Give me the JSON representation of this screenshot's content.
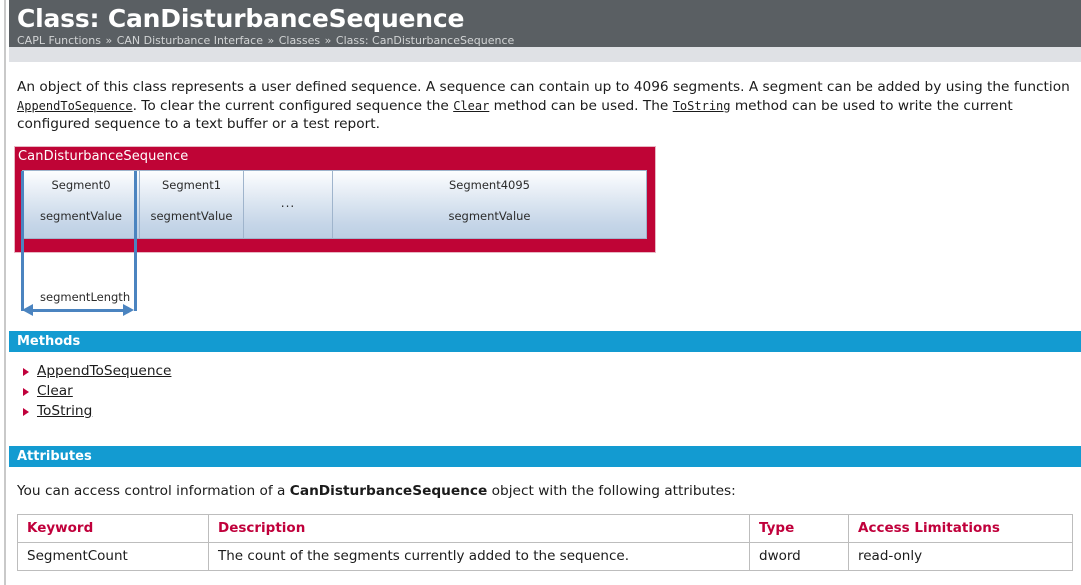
{
  "header": {
    "title": "Class: CanDisturbanceSequence",
    "breadcrumb": [
      "CAPL Functions",
      "CAN Disturbance Interface",
      "Classes",
      "Class: CanDisturbanceSequence"
    ],
    "separator": "»"
  },
  "intro": {
    "part1": "An object of this class represents a user defined sequence. A sequence can contain up to 4096 segments. A segment can be added by using the function ",
    "link1": "AppendToSequence",
    "part2": ". To clear the current configured sequence the ",
    "link2": "Clear",
    "part3": " method can be used. The ",
    "link3": "ToString",
    "part4": " method can be used to write the current configured sequence to a text buffer or a test report."
  },
  "diagram": {
    "class_label": "CanDisturbanceSequence",
    "segments": [
      {
        "name": "Segment0",
        "value": "segmentValue"
      },
      {
        "name": "Segment1",
        "value": "segmentValue"
      },
      {
        "name": "",
        "value": "",
        "ellipsis": "..."
      },
      {
        "name": "Segment4095",
        "value": "segmentValue"
      }
    ],
    "measure_label": "segmentLength",
    "colors": {
      "class_box": "#bf0436",
      "segment_border": "#9fb4cc",
      "measure_line": "#4b84c0"
    }
  },
  "methods": {
    "section_title": "Methods",
    "items": [
      "AppendToSequence",
      "Clear",
      "ToString"
    ]
  },
  "attributes": {
    "section_title": "Attributes",
    "intro_before": "You can access control information of a ",
    "intro_bold": "CanDisturbanceSequence",
    "intro_after": " object with the following attributes:",
    "table": {
      "headers": [
        "Keyword",
        "Description",
        "Type",
        "Access Limitations"
      ],
      "rows": [
        {
          "keyword": "SegmentCount",
          "description": "The count of the segments currently added to the sequence.",
          "type": "dword",
          "access": "read-only"
        }
      ]
    }
  },
  "theme": {
    "header_bg": "#5a5f63",
    "section_bar": "#139bd1",
    "accent_red": "#c0003b"
  }
}
